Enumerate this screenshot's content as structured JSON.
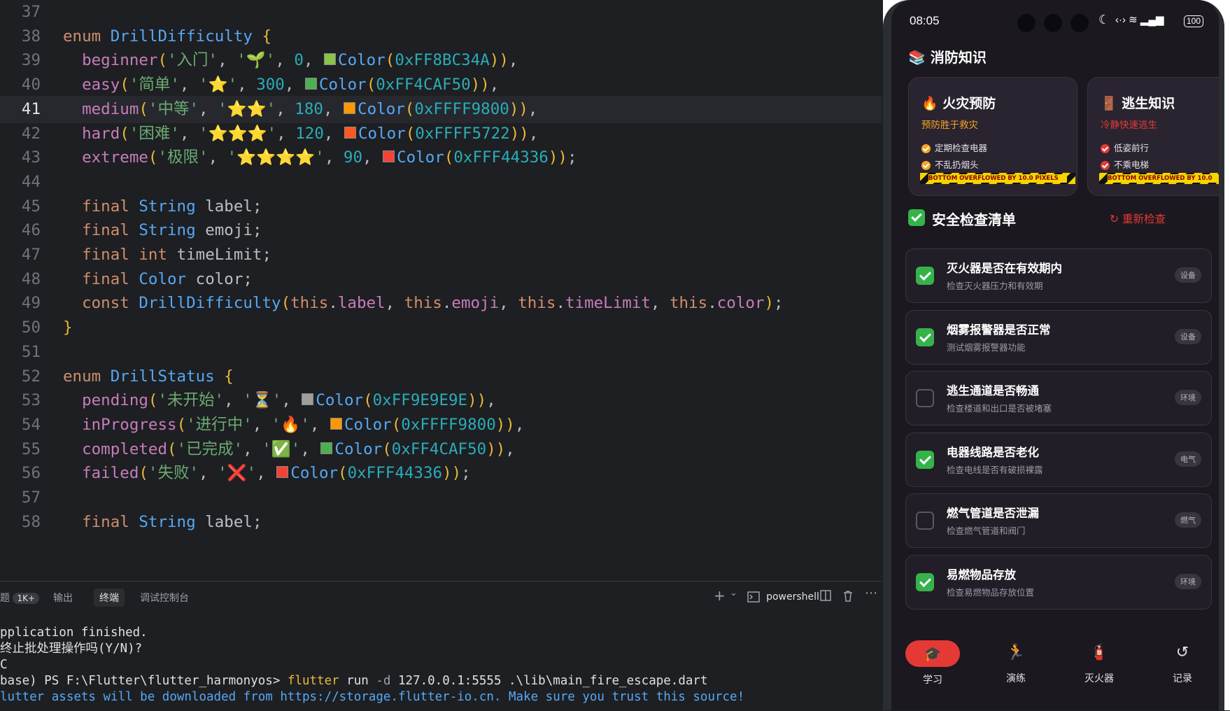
{
  "editor": {
    "active_line": "41",
    "lines": [
      {
        "n": "37",
        "t": ""
      },
      {
        "n": "38",
        "t": "enum DrillDifficulty {"
      },
      {
        "n": "39",
        "t": "  beginner('入门', '🌱', 0, Color(0xFF8BC34A)),"
      },
      {
        "n": "40",
        "t": "  easy('简单', '⭐', 300, Color(0xFF4CAF50)),"
      },
      {
        "n": "41",
        "t": "  medium('中等', '⭐⭐', 180, Color(0xFFFF9800)),"
      },
      {
        "n": "42",
        "t": "  hard('困难', '⭐⭐⭐', 120, Color(0xFFFF5722)),"
      },
      {
        "n": "43",
        "t": "  extreme('极限', '⭐⭐⭐⭐', 90, Color(0xFFF44336));"
      },
      {
        "n": "44",
        "t": ""
      },
      {
        "n": "45",
        "t": "  final String label;"
      },
      {
        "n": "46",
        "t": "  final String emoji;"
      },
      {
        "n": "47",
        "t": "  final int timeLimit;"
      },
      {
        "n": "48",
        "t": "  final Color color;"
      },
      {
        "n": "49",
        "t": "  const DrillDifficulty(this.label, this.emoji, this.timeLimit, this.color);"
      },
      {
        "n": "50",
        "t": "}"
      },
      {
        "n": "51",
        "t": ""
      },
      {
        "n": "52",
        "t": "enum DrillStatus {"
      },
      {
        "n": "53",
        "t": "  pending('未开始', '⏳', Color(0xFF9E9E9E)),"
      },
      {
        "n": "54",
        "t": "  inProgress('进行中', '🔥', Color(0xFFFF9800)),"
      },
      {
        "n": "55",
        "t": "  completed('已完成', '✅', Color(0xFF4CAF50)),"
      },
      {
        "n": "56",
        "t": "  failed('失败', '❌', Color(0xFFF44336));"
      },
      {
        "n": "57",
        "t": ""
      },
      {
        "n": "58",
        "t": "  final String label;"
      }
    ]
  },
  "panel": {
    "tabs": [
      "题",
      "输出",
      "终端",
      "调试控制台"
    ],
    "problems_badge": "1K+",
    "selected_tab": "终端",
    "add_icon": "+",
    "dropdown_icon": "⌄",
    "shell_name": "powershell",
    "terminal_lines": [
      "pplication finished.",
      "终止批处理操作吗(Y/N)?",
      "C",
      "base) PS F:\\Flutter\\flutter_harmonyos> flutter run -d 127.0.0.1:5555 .\\lib\\main_fire_escape.dart",
      "lutter assets will be downloaded from https://storage.flutter-io.cn. Make sure you trust this source!"
    ],
    "prompt_prefix": "base) PS F:\\Flutter\\flutter_harmonyos> ",
    "cmd_word": "flutter",
    "cmd_rest": " run ",
    "cmd_flag": "-d",
    "cmd_args": " 127.0.0.1:5555 .\\lib\\main_fire_escape.dart"
  },
  "phone": {
    "status": {
      "time": "08:05",
      "battery": "100"
    },
    "app_title": "消防知识",
    "title_icon": "📚",
    "knowledge_cards": [
      {
        "icon": "🔥",
        "title": "火灾预防",
        "subtitle": "预防胜于救灾",
        "items": [
          "定期检查电器",
          "不乱扔烟头"
        ],
        "overflow": "BOTTOM OVERFLOWED BY 10.0 PIXELS"
      },
      {
        "icon": "🚪",
        "title": "逃生知识",
        "subtitle": "冷静快速逃生",
        "items": [
          "低姿前行",
          "不乘电梯"
        ],
        "overflow": "BOTTOM OVERFLOWED BY 10.0"
      }
    ],
    "checklist": {
      "title": "安全检查清单",
      "reset_label": "重新检查",
      "items": [
        {
          "title": "灭火器是否在有效期内",
          "sub": "检查灭火器压力和有效期",
          "tag": "设备",
          "checked": true
        },
        {
          "title": "烟雾报警器是否正常",
          "sub": "测试烟雾报警器功能",
          "tag": "设备",
          "checked": true
        },
        {
          "title": "逃生通道是否畅通",
          "sub": "检查楼道和出口是否被堵塞",
          "tag": "环境",
          "checked": false
        },
        {
          "title": "电器线路是否老化",
          "sub": "检查电线是否有破损裸露",
          "tag": "电气",
          "checked": true
        },
        {
          "title": "燃气管道是否泄漏",
          "sub": "检查燃气管道和阀门",
          "tag": "燃气",
          "checked": false
        },
        {
          "title": "易燃物品存放",
          "sub": "检查易燃物品存放位置",
          "tag": "环境",
          "checked": true
        }
      ]
    },
    "nav": [
      {
        "label": "学习",
        "icon": "graduation-cap-icon",
        "selected": true
      },
      {
        "label": "演练",
        "icon": "running-person-icon",
        "selected": false
      },
      {
        "label": "灭火器",
        "icon": "fire-extinguisher-icon",
        "selected": false
      },
      {
        "label": "记录",
        "icon": "history-icon",
        "selected": false
      }
    ],
    "colors": {
      "accent": "#e53935",
      "check": "#35b34a",
      "orange": "#f6a623"
    }
  }
}
